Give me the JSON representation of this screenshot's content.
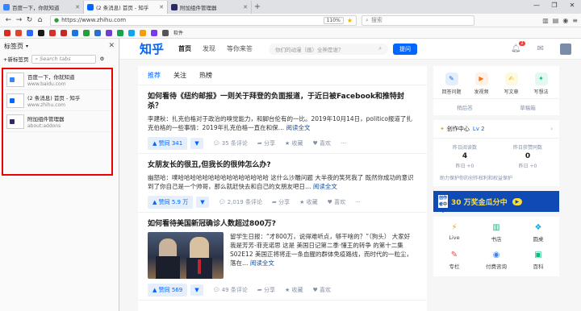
{
  "tabs": [
    {
      "title": "百度一下，你就知道",
      "color": "#3385ff",
      "active": false
    },
    {
      "title": "(2 条消息) 首页 - 知乎",
      "color": "#0066ff",
      "active": true
    },
    {
      "title": "附加组件管理器",
      "color": "#2a2a6a",
      "active": false
    }
  ],
  "nav": {
    "url": "https://www.zhihu.com",
    "zoom": "110%",
    "search_placeholder": "搜索"
  },
  "bookmarks": {
    "folder_label": "软件",
    "colors": [
      "#d92d20",
      "#e0442e",
      "#2a6df4",
      "#1a1a1a",
      "#d9302a",
      "#c62828",
      "#1b74e4",
      "#2a9d3a",
      "#2a72c9",
      "#6e3fd0",
      "#17a34a",
      "#0ea5e9",
      "#f59e0b",
      "#7c3aed",
      "#555555"
    ]
  },
  "sidebar": {
    "title": "标签页",
    "new_tab": "+新标签页",
    "search_placeholder": "Search tabs",
    "items": [
      {
        "title": "百度一下，你就知道",
        "url": "www.baidu.com",
        "color": "#3385ff"
      },
      {
        "title": "(2 条消息) 首页 - 知乎",
        "url": "www.zhihu.com",
        "color": "#0066ff"
      },
      {
        "title": "附加组件管理器",
        "url": "about:addons",
        "color": "#2a2a6a"
      }
    ]
  },
  "zhihu": {
    "logo": "知乎",
    "nav": [
      "首页",
      "发现",
      "等你来答"
    ],
    "search_placeholder": "你们的动漫（画）全神是谁？",
    "ask": "提问",
    "notif_count": "2",
    "feed_tabs": [
      "推荐",
      "关注",
      "热榜"
    ],
    "cards": [
      {
        "title": "如何看待《纽约邮报》一则关于拜登的负面报道，于近日被Facebook和推特封杀？",
        "excerpt": "李建秋：扎克伯格对于政治的嗅觉能力，和脚台伦有的一比。2019年10月14日，politico报道了扎克伯格的一些事情：2019年扎克伯格一直在和保…",
        "read_more": "阅读全文",
        "votes": "赞同 341",
        "comments": "35 条评论",
        "share": "分享",
        "fav": "收藏",
        "like": "喜欢"
      },
      {
        "title": "女朋友长的很丑,但我长的很帅怎么办?",
        "excerpt": "幽怒哈：噗哈哈哈哈哈哈哈哈哈哈哈哈哈哈哈 这什么沙雕问题 大半夜的笑死我了 既然你成功的意识到了你自己是一个帅哥，那么就赶快去和自己的女朋友吧日…",
        "read_more": "阅读全文",
        "votes": "赞同 5.9 万",
        "comments": "2,019 条评论",
        "share": "分享",
        "fav": "收藏",
        "like": "喜欢"
      },
      {
        "title": "如何看待美国新冠确诊人数超过800万?",
        "excerpt": "留学生日报：“才800万，说得难听点，够干啥的？”（狗头） 大家好 我是芳芳-菲克诺思 这是 美国日记第二季·懂王的转争 的第十二集 S02E12 美国正将将走一条血腥的群体免疫路线，而时代的一粒尘，落在…",
        "read_more": "阅读全文",
        "votes": "赞同 569",
        "comments": "49 条评论",
        "share": "分享",
        "fav": "收藏",
        "like": "喜欢"
      }
    ],
    "quick": [
      {
        "label": "回答问题",
        "icon": "answer-icon",
        "color": "#0066ff",
        "bg": "#e5effb",
        "glyph": "✎"
      },
      {
        "label": "发视频",
        "icon": "video-icon",
        "color": "#f97316",
        "bg": "#fff1e6",
        "glyph": "▶"
      },
      {
        "label": "写文章",
        "icon": "article-icon",
        "color": "#eab308",
        "bg": "#fef9e1",
        "glyph": "✍"
      },
      {
        "label": "写想法",
        "icon": "idea-icon",
        "color": "#10b981",
        "bg": "#e3f8ef",
        "glyph": "✦"
      }
    ],
    "quick_bottom": [
      "稍后答",
      "草稿箱"
    ],
    "creator": {
      "title": "创作中心",
      "level": "Lv 2",
      "stats": [
        {
          "label": "昨日阅读数",
          "value": "4",
          "sub": "昨日 +0"
        },
        {
          "label": "昨日获赞同数",
          "value": "0",
          "sub": "昨日 +0"
        }
      ],
      "tip": "助力保护你的创作权利和权益保护"
    },
    "banner": {
      "text": "30 万奖金瓜分中",
      "tag": "创作者中心",
      "go": "▶"
    },
    "grid": [
      {
        "label": "Live",
        "icon": "live-icon",
        "glyph": "⚡",
        "color": "#f59e0b"
      },
      {
        "label": "书店",
        "icon": "bookstore-icon",
        "glyph": "▥",
        "color": "#10b981"
      },
      {
        "label": "圆桌",
        "icon": "roundtable-icon",
        "glyph": "❖",
        "color": "#0ea5e9"
      },
      {
        "label": "专栏",
        "icon": "column-icon",
        "glyph": "✎",
        "color": "#ef4444"
      },
      {
        "label": "付费咨询",
        "icon": "consult-icon",
        "glyph": "◉",
        "color": "#3b82f6"
      },
      {
        "label": "百科",
        "icon": "wiki-icon",
        "glyph": "▣",
        "color": "#10b981"
      }
    ]
  }
}
